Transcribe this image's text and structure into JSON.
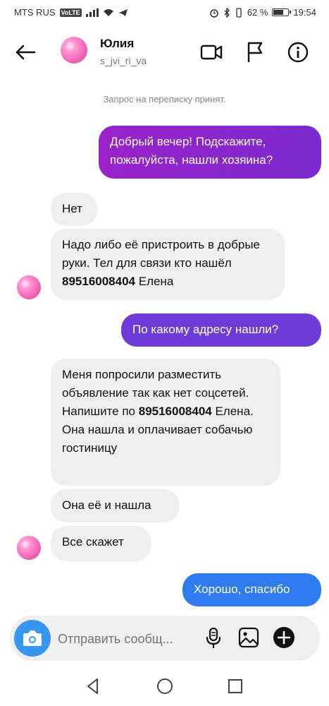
{
  "status_bar": {
    "carrier": "MTS RUS",
    "volte": "VoLTE",
    "battery_percent": "62 %",
    "time": "19:54"
  },
  "header": {
    "name": "Юлия",
    "username": "s_jvi_ri_va"
  },
  "chat": {
    "request_note": "Запрос на переписку принят.",
    "messages": [
      {
        "from": "me",
        "text": "Добрый вечер! Подскажите, пожалуйста, нашли хозяина?"
      },
      {
        "from": "them",
        "text": "Нет"
      },
      {
        "from": "them",
        "parts": [
          "Надо либо её пристроить  в добрые руки. Тел для связи кто нашёл ",
          "89516008404",
          " Елена"
        ]
      },
      {
        "from": "me",
        "text": "По какому адресу нашли?"
      },
      {
        "from": "them",
        "parts": [
          "Меня попросили разместить объявление так как нет соцсетей. Напишите по ",
          "89516008404",
          " Елена. Она нашла и оплачивает собачью гостиницу"
        ]
      },
      {
        "from": "them",
        "text": "Она её и нашла"
      },
      {
        "from": "them",
        "text": "Все скажет"
      },
      {
        "from": "me",
        "text": "Хорошо, спасибо"
      }
    ]
  },
  "composer": {
    "placeholder": "Отправить сообщ..."
  },
  "colors": {
    "out_purple_1": "#9a22c9",
    "out_purple_2": "#6e3bd8",
    "out_blue": "#2f7cf0",
    "incoming": "#efefef",
    "camera": "#3797f0"
  }
}
